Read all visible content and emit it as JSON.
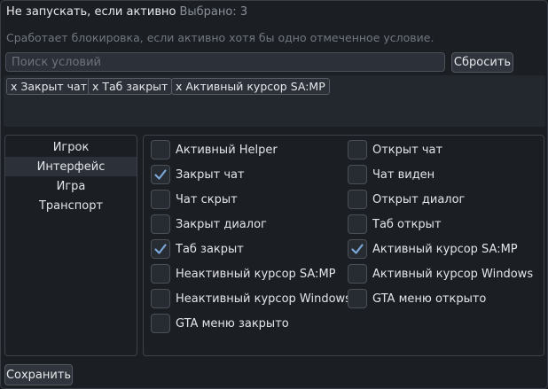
{
  "header": {
    "title": "Не запускать, если активно",
    "selected": "Выбрано: 3"
  },
  "hint": "Сработает блокировка, если активно хотя бы одно отмеченное условие.",
  "search": {
    "placeholder": "Поиск условий",
    "value": ""
  },
  "reset_label": "Сбросить",
  "chips": [
    "x Закрыт чат",
    "x Таб закрыт",
    "x Активный курсор SA:MP"
  ],
  "sidebar": {
    "items": [
      {
        "label": "Игрок",
        "active": false
      },
      {
        "label": "Интерфейс",
        "active": true
      },
      {
        "label": "Игра",
        "active": false
      },
      {
        "label": "Транспорт",
        "active": false
      }
    ]
  },
  "options_left": [
    {
      "label": "Активный Helper",
      "checked": false
    },
    {
      "label": "Закрыт чат",
      "checked": true
    },
    {
      "label": "Чат скрыт",
      "checked": false
    },
    {
      "label": "Закрыт диалог",
      "checked": false
    },
    {
      "label": "Таб закрыт",
      "checked": true
    },
    {
      "label": "Неактивный курсор SA:MP",
      "checked": false
    },
    {
      "label": "Неактивный курсор Windows",
      "checked": false
    },
    {
      "label": "GTA меню закрыто",
      "checked": false
    }
  ],
  "options_right": [
    {
      "label": "Открыт чат",
      "checked": false
    },
    {
      "label": "Чат виден",
      "checked": false
    },
    {
      "label": "Открыт диалог",
      "checked": false
    },
    {
      "label": "Таб открыт",
      "checked": false
    },
    {
      "label": "Активный курсор SA:MP",
      "checked": true
    },
    {
      "label": "Активный курсор Windows",
      "checked": false
    },
    {
      "label": "GTA меню открыто",
      "checked": false
    }
  ],
  "save_label": "Сохранить",
  "colors": {
    "check": "#7aa7d8",
    "background": "#1b1e23",
    "border": "#3e434b"
  }
}
